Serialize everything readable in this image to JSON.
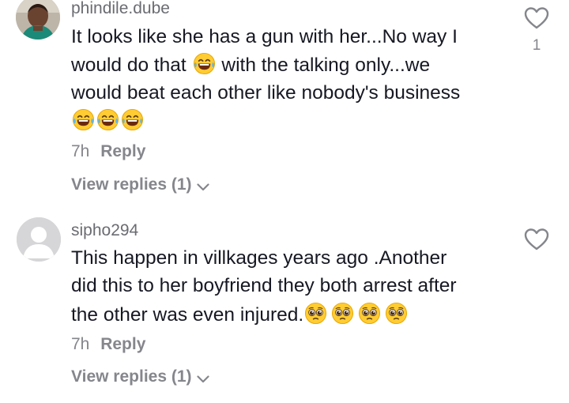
{
  "comments": [
    {
      "username": "phindile.dube",
      "line1": "It looks like she has a gun with her...No way I",
      "line2a": "would do that",
      "line2b": "with the talking only...we",
      "line3": "would beat each other like nobody's business",
      "emoji_line": "laughing-tears x3",
      "time": "7h",
      "reply_label": "Reply",
      "view_replies": "View replies (1)",
      "like_count": "1"
    },
    {
      "username": "sipho294",
      "line1": "This happen in villkages years ago .Another",
      "line2": "did this to her boyfriend they both arrest after",
      "line3": "the other was even injured.",
      "time": "7h",
      "reply_label": "Reply",
      "view_replies": "View replies (1)",
      "like_count": ""
    }
  ],
  "colors": {
    "text_primary": "#161823",
    "text_secondary": "#85868c",
    "username": "#6b6c72"
  },
  "icons": [
    "heart-outline-icon",
    "chevron-down-icon",
    "laughing-tears-emoji",
    "pleading-face-emoji",
    "default-avatar-icon"
  ]
}
